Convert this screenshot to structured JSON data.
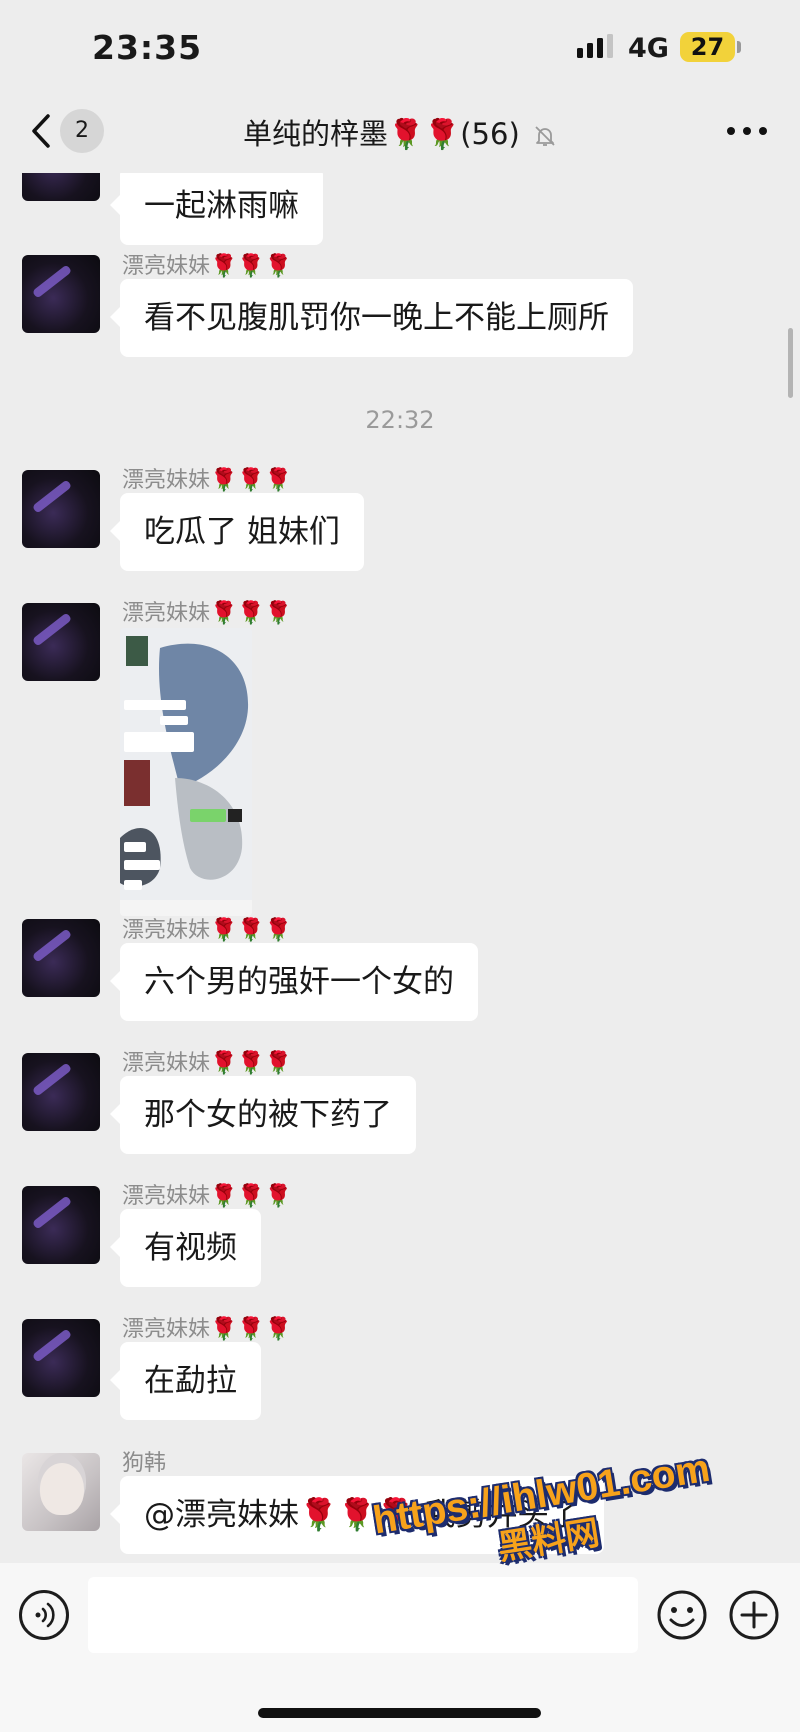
{
  "status_bar": {
    "time": "23:35",
    "network": "4G",
    "battery": "27"
  },
  "header": {
    "back_badge": "2",
    "title": "单纯的梓墨🌹🌹(56)"
  },
  "messages": [
    {
      "sender": "",
      "text": "一起淋雨嘛"
    },
    {
      "sender": "漂亮妹妹🌹🌹🌹",
      "text": "看不见腹肌罚你一晚上不能上厕所"
    },
    {
      "timestamp": "22:32"
    },
    {
      "sender": "漂亮妹妹🌹🌹🌹",
      "text": "吃瓜了 姐妹们"
    },
    {
      "sender": "漂亮妹妹🌹🌹🌹",
      "type": "image"
    },
    {
      "sender": "漂亮妹妹🌹🌹🌹",
      "text": "六个男的强奸一个女的"
    },
    {
      "sender": "漂亮妹妹🌹🌹🌹",
      "text": "那个女的被下药了"
    },
    {
      "sender": "漂亮妹妹🌹🌹🌹",
      "text": "有视频"
    },
    {
      "sender": "漂亮妹妹🌹🌹🌹",
      "text": "在勐拉"
    },
    {
      "sender": "狗韩",
      "text": "@漂亮妹妹🌹🌹🌹 我剪并头了"
    }
  ],
  "input": {
    "value": ""
  },
  "watermark": {
    "url": "https://ihlw01.com",
    "name": "黑料网"
  },
  "icons": [
    "back-chevron-icon",
    "mute-bell-icon",
    "more-dots-icon",
    "voice-icon",
    "emoji-icon",
    "plus-icon"
  ],
  "colors": {
    "background": "#ededed",
    "bubble": "#ffffff",
    "battery": "#f2d23a",
    "watermark": "#f7a21b"
  }
}
